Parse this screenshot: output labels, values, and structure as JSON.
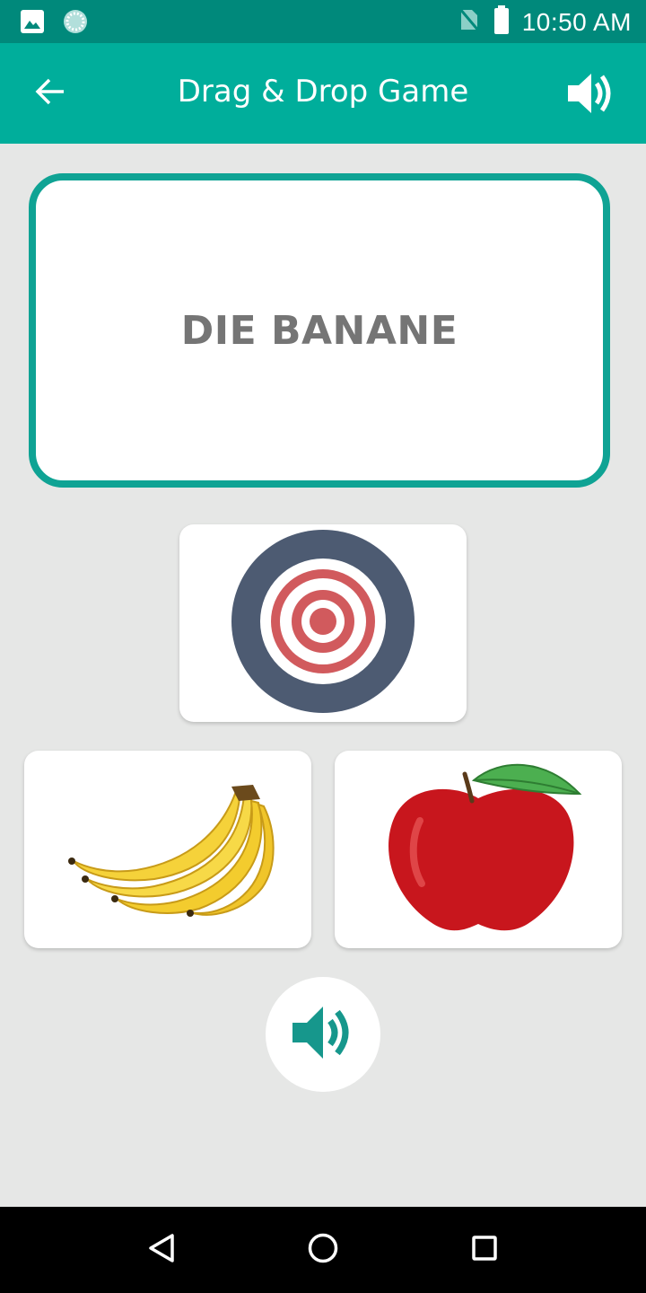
{
  "status_bar": {
    "time": "10:50 AM",
    "icons": [
      "image-icon",
      "sync-icon",
      "no-sim-icon",
      "battery-icon"
    ]
  },
  "app_bar": {
    "title": "Drag & Drop Game",
    "back_icon": "arrow-left-icon",
    "sound_icon": "volume-icon"
  },
  "game": {
    "word": "DIE BANANE",
    "target_icon": "target-icon",
    "choices": [
      {
        "name": "banana",
        "icon": "banana-image"
      },
      {
        "name": "apple",
        "icon": "apple-image"
      }
    ],
    "play_icon": "volume-icon"
  },
  "nav_bar": {
    "icons": [
      "back-triangle-icon",
      "home-circle-icon",
      "recents-square-icon"
    ]
  },
  "colors": {
    "status_bar": "#00897b",
    "app_bar": "#00ae9b",
    "accent": "#0fa394",
    "background": "#e6e7e6",
    "word_text": "#757575"
  }
}
